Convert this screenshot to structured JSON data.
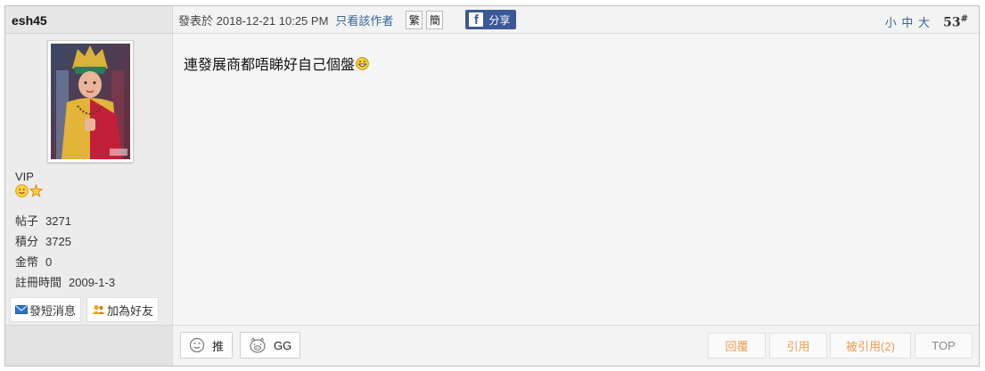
{
  "author": {
    "username": "esh45",
    "group": "VIP",
    "stats": [
      {
        "label": "帖子",
        "value": "3271"
      },
      {
        "label": "積分",
        "value": "3725"
      },
      {
        "label": "金幣",
        "value": "0"
      },
      {
        "label": "註冊時間",
        "value": "2009-1-3"
      }
    ],
    "buttons": {
      "pm": "發短消息",
      "add_friend": "加為好友"
    },
    "rank_icons": [
      "smiley-face-icon",
      "star-icon"
    ]
  },
  "post": {
    "posted_prefix": "發表於",
    "posted_time": "2018-12-21 10:25 PM",
    "only_author": "只看該作者",
    "traditional": "繁",
    "simplified": "簡",
    "share": "分享",
    "font_size": "小 中 大",
    "floor": "53",
    "floor_suffix": "#",
    "content": "連發展商都唔睇好自己個盤"
  },
  "footer": {
    "push": "推",
    "gg": "GG",
    "reply": "回覆",
    "quote": "引用",
    "quoted": "被引用(2)",
    "top": "TOP"
  },
  "colors": {
    "link": "#336699",
    "action_text": "#f39c50",
    "facebook": "#3b5998"
  }
}
